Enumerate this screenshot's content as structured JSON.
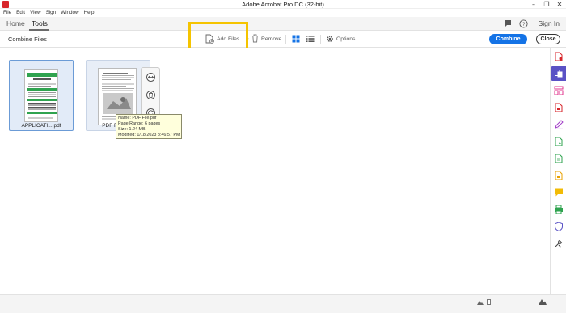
{
  "window": {
    "title": "Adobe Acrobat Pro DC (32-bit)",
    "controls": [
      "–",
      "❐",
      "✕"
    ]
  },
  "menu": [
    "File",
    "Edit",
    "View",
    "Sign",
    "Window",
    "Help"
  ],
  "nav": {
    "tabs": [
      "Home",
      "Tools"
    ],
    "active_tab": "Tools",
    "sign_in": "Sign In"
  },
  "toolbar": {
    "tool_name": "Combine Files",
    "add_files": "Add Files...",
    "remove": "Remove",
    "options": "Options",
    "combine": "Combine",
    "close": "Close"
  },
  "files": [
    {
      "label": "APPLICATI....pdf"
    },
    {
      "label": "PDF F"
    }
  ],
  "tooltip": {
    "name": "Name: PDF File.pdf",
    "page_range": "Page Range: 6 pages",
    "size": "Size: 1.24 MB",
    "modified": "Modified: 1/18/2023 8:46:57 PM"
  },
  "colors": {
    "accent": "#1473e6",
    "highlight": "#f5c400",
    "active_tool": "#5a52c5",
    "acrobat_red": "#d7262b"
  },
  "right_tools": [
    "export-pdf-icon",
    "combine-files-icon",
    "organize-pages-icon",
    "create-pdf-icon",
    "fill-sign-icon",
    "edit-pdf-icon",
    "scan-icon",
    "export-icon",
    "comment-icon",
    "print-production-icon",
    "protect-icon",
    "more-tools-icon"
  ]
}
